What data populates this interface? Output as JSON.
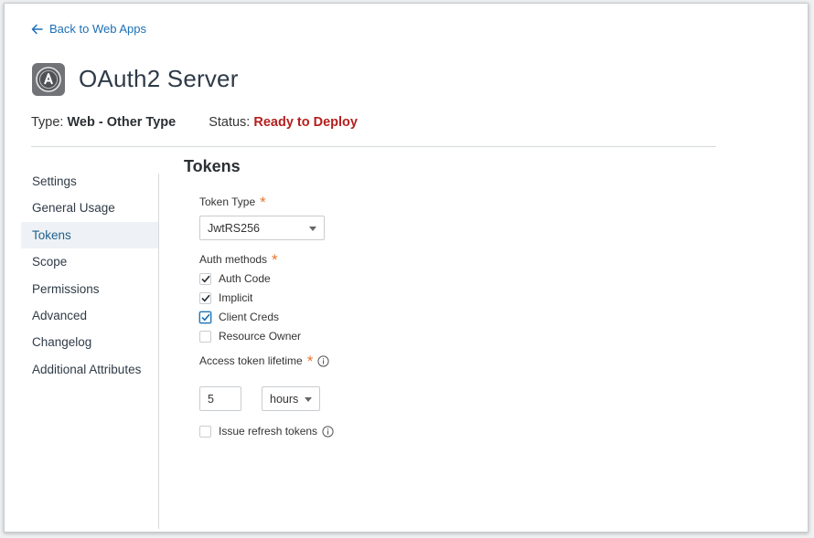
{
  "header": {
    "back_link": "Back to Web Apps",
    "title": "OAuth2 Server",
    "type_label": "Type:",
    "type_value": "Web - Other Type",
    "status_label": "Status:",
    "status_value": "Ready to Deploy"
  },
  "colors": {
    "accent": "#1b6fb5",
    "status": "#b3201e",
    "required": "#e8772e",
    "active_nav_bg": "#eef2f6"
  },
  "sidebar": {
    "items": [
      {
        "label": "Settings",
        "active": false
      },
      {
        "label": "General Usage",
        "active": false
      },
      {
        "label": "Tokens",
        "active": true
      },
      {
        "label": "Scope",
        "active": false
      },
      {
        "label": "Permissions",
        "active": false
      },
      {
        "label": "Advanced",
        "active": false
      },
      {
        "label": "Changelog",
        "active": false
      },
      {
        "label": "Additional Attributes",
        "active": false
      }
    ]
  },
  "main": {
    "section_title": "Tokens",
    "token_type": {
      "label": "Token Type",
      "required_mark": "*",
      "value": "JwtRS256"
    },
    "auth_methods": {
      "label": "Auth methods",
      "required_mark": "*",
      "options": [
        {
          "label": "Auth Code",
          "checked": true
        },
        {
          "label": "Implicit",
          "checked": true
        },
        {
          "label": "Client Creds",
          "checked": true
        },
        {
          "label": "Resource Owner",
          "checked": false
        }
      ]
    },
    "lifetime": {
      "label": "Access token lifetime",
      "required_mark": "*",
      "info_icon": "info-icon",
      "value": "5",
      "unit": "hours"
    },
    "refresh": {
      "label": "Issue refresh tokens",
      "checked": false,
      "info_icon": "info-icon"
    }
  }
}
